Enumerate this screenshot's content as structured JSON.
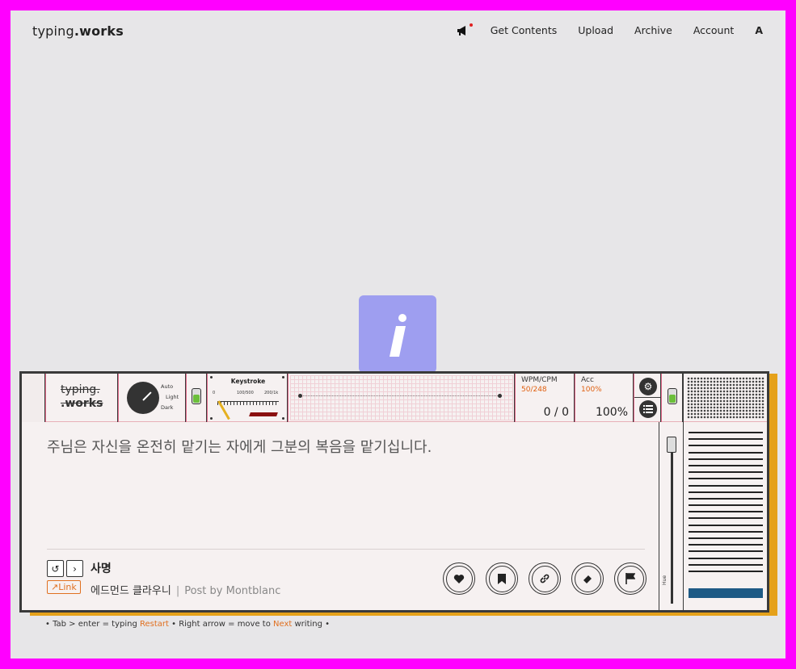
{
  "nav": {
    "logo_light": "typing",
    "logo_bold": ".works",
    "items": [
      "Get Contents",
      "Upload",
      "Archive",
      "Account"
    ],
    "lang": "A"
  },
  "device": {
    "mini_logo_line1": "typing.",
    "mini_logo_line2": ".works",
    "theme_labels": [
      "Auto",
      "Light",
      "Dark"
    ],
    "keystroke": {
      "title": "Keystroke",
      "scale": [
        "0",
        "100/500",
        "200/1k"
      ]
    },
    "wpm": {
      "label": "WPM/CPM",
      "sub": "50/248",
      "value": "0 / 0"
    },
    "acc": {
      "label": "Acc",
      "sub": "100%",
      "value": "100%"
    },
    "hue_label": "Hue"
  },
  "content": {
    "text": "주님은 자신을 온전히 맡기는 자에게 그분의 복음을 맡기십니다.",
    "title": "사명",
    "link_label": "↗Link",
    "author": "에드먼드 클라우니",
    "post_by": "Post by Montblanc"
  },
  "footer": {
    "part1": "• Tab > enter = typing ",
    "restart": "Restart",
    "part2": " • Right arrow = move to ",
    "next": "Next",
    "part3": " writing •"
  },
  "colors": {
    "accent": "#e07020",
    "tile": "#9e9ef0",
    "shadow": "#e5a11a",
    "bluebar": "#1e5a85",
    "border": "#ff00ff"
  }
}
